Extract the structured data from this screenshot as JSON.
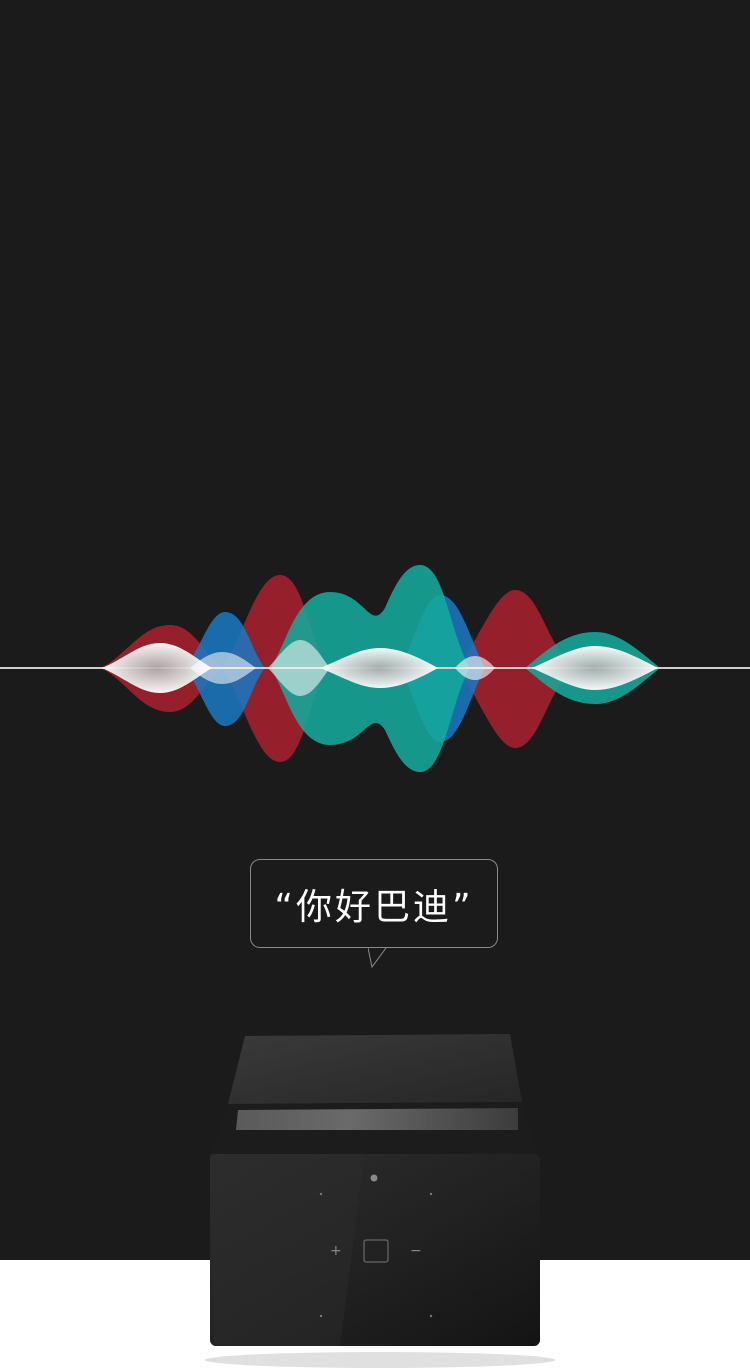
{
  "speech_bubble": {
    "text": "“你好巴迪”"
  },
  "device": {
    "buttons": {
      "plus": "+",
      "minus": "−"
    }
  },
  "colors": {
    "background": "#1b1b1b",
    "wave_red": "#a3212f",
    "wave_blue": "#1a79c2",
    "wave_teal": "#15a89b",
    "wave_white": "#e8e8e8"
  }
}
